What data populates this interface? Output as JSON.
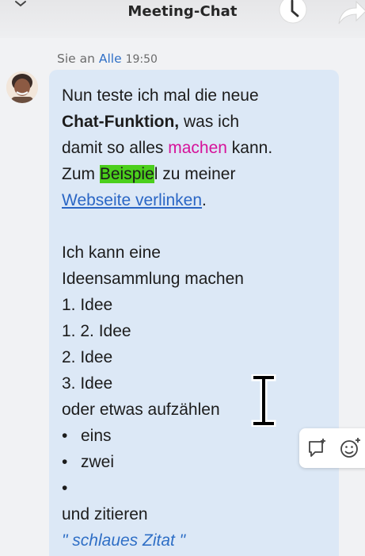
{
  "header": {
    "title": "Meeting-Chat",
    "icons": [
      "chevron-down-icon",
      "clock-icon",
      "share-arrow-icon"
    ]
  },
  "message": {
    "sender_prefix": "Sie an",
    "recipient": "Alle",
    "time": "19:50",
    "avatar": "avatar",
    "lines": {
      "l1": "Nun teste ich mal die neue",
      "l2_bold": "Chat-Funktion,",
      "l2_rest": " was ich",
      "l3_start": "damit so alles ",
      "l3_colored": "machen",
      "l3_end": " kann.",
      "l4_start": "Zum ",
      "l4_highlight": "Beispie",
      "l4_end": "l zu meiner",
      "l5_link": "Webseite verlinken",
      "l5_end": ".",
      "l6": "Ich kann eine",
      "l7": "Ideensammlung machen",
      "l8": "1. Idee",
      "l9": "1. 2. Idee",
      "l10": "2. Idee",
      "l11": "3. Idee",
      "l12": "oder etwas aufzählen",
      "bullet": "•",
      "b1": "eins",
      "b2": "zwei",
      "l13": "und zitieren",
      "quote": "\" schlaues Zitat \""
    },
    "colors": {
      "magenta": "#d6129a",
      "highlight": "#4bcf1c",
      "link": "#2a66c5",
      "bubble": "#dce8f6"
    }
  },
  "actions": {
    "reply_icon": "reply-bubble-icon",
    "react_icon": "add-reaction-icon"
  }
}
